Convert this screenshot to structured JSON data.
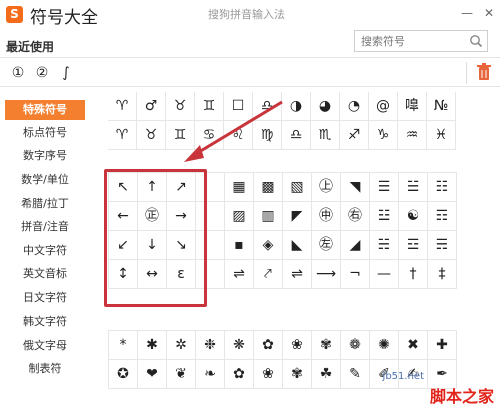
{
  "app": {
    "logo_char": "S",
    "title": "符号大全",
    "caption": "搜狗拼音输入法",
    "controls": [
      "—",
      "✕"
    ]
  },
  "recent": {
    "label": "最近使用",
    "items": [
      "①",
      "②",
      "∫"
    ]
  },
  "search": {
    "placeholder": "搜索符号"
  },
  "sidebar": {
    "items": [
      {
        "label": "特殊符号",
        "active": true
      },
      {
        "label": "标点符号",
        "active": false
      },
      {
        "label": "数字序号",
        "active": false
      },
      {
        "label": "数学/单位",
        "active": false
      },
      {
        "label": "希腊/拉丁",
        "active": false
      },
      {
        "label": "拼音/注音",
        "active": false
      },
      {
        "label": "中文字符",
        "active": false
      },
      {
        "label": "英文音标",
        "active": false
      },
      {
        "label": "日文字符",
        "active": false
      },
      {
        "label": "韩文字符",
        "active": false
      },
      {
        "label": "俄文字母",
        "active": false
      },
      {
        "label": "制表符",
        "active": false
      }
    ]
  },
  "grids": {
    "top": [
      [
        "♈",
        "♂",
        "♉",
        "♊",
        "☐",
        "♎",
        "◑",
        "◕",
        "◔",
        "@",
        "嘷",
        "№"
      ],
      [
        "♈",
        "♉",
        "♊",
        "♋",
        "♌",
        "♍",
        "♎",
        "♏",
        "♐",
        "♑",
        "♒",
        "♓"
      ]
    ],
    "middle": [
      [
        "↖",
        "↑",
        "↗",
        "",
        "▦",
        "▩",
        "▧",
        "㊤",
        "◥",
        "☰",
        "☱",
        "☷"
      ],
      [
        "←",
        "㊣",
        "→",
        "",
        "▨",
        "▥",
        "◤",
        "㊥",
        "㊨",
        "☳",
        "☯",
        "☶"
      ],
      [
        "↙",
        "↓",
        "↘",
        "",
        "▪",
        "◈",
        "◣",
        "㊧",
        "◢",
        "☵",
        "☲",
        "☴"
      ],
      [
        "↕",
        "↔",
        "ε",
        "",
        "⇌",
        "⤤",
        "⇌",
        "⟶",
        "¬",
        "—",
        "†",
        "‡"
      ]
    ],
    "bottom": [
      [
        "*",
        "✱",
        "✲",
        "❉",
        "❋",
        "✿",
        "❀",
        "✾",
        "❁",
        "✺",
        "✖",
        "✚"
      ],
      [
        "✪",
        "❤",
        "❦",
        "❧",
        "✿",
        "❀",
        "✾",
        "☘",
        "✎",
        "✐",
        "✍",
        "✒"
      ]
    ]
  },
  "watermark": {
    "main": "脚本之家",
    "url": "jb51.net"
  },
  "colors": {
    "accent": "#f37f2f",
    "annotation": "#c8343a"
  }
}
